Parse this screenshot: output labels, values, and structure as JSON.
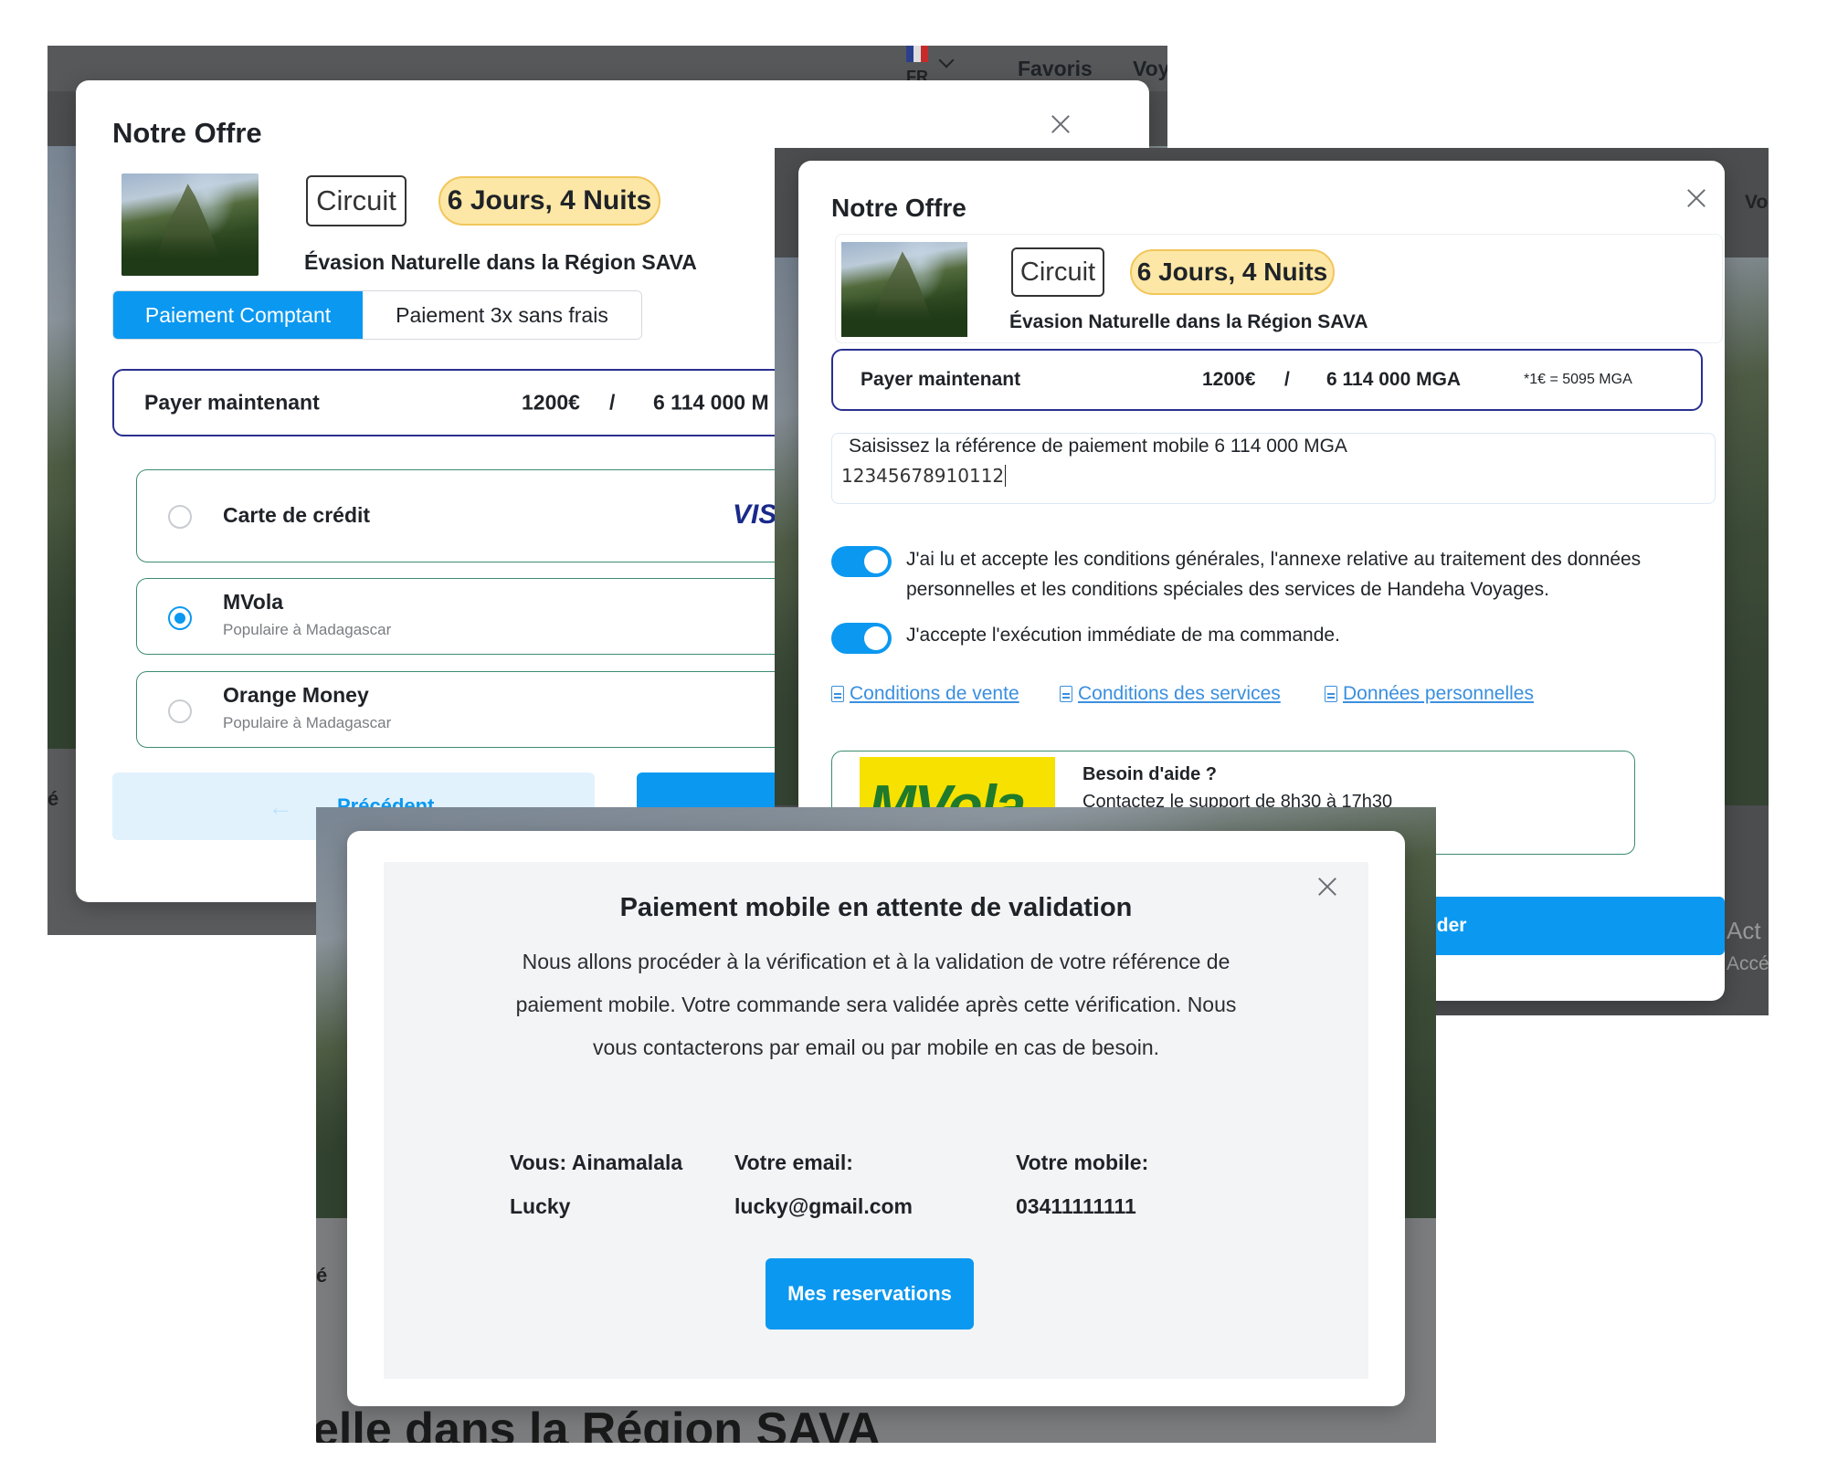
{
  "screenshot1": {
    "nav": {
      "lang": "FR",
      "favorites": "Favoris",
      "voyages_fragment": "Voy"
    },
    "modal": {
      "title": "Notre Offre",
      "badge_type": "Circuit",
      "badge_duration": "6 Jours, 4 Nuits",
      "offer_name": "Évasion Naturelle dans la Région SAVA",
      "tabs": [
        "Paiement Comptant",
        "Paiement 3x sans frais"
      ],
      "pay_label": "Payer maintenant",
      "price_eur": "1200€",
      "separator": "/",
      "price_mga_partial": "6 114 000 M",
      "methods": [
        {
          "title": "Carte de crédit",
          "subtitle": "",
          "selected": false,
          "logo": "VIS"
        },
        {
          "title": "MVola",
          "subtitle": "Populaire à Madagascar",
          "selected": true
        },
        {
          "title": "Orange Money",
          "subtitle": "Populaire à Madagascar",
          "selected": false
        }
      ],
      "prev_button": "Précédent"
    },
    "bg_fragment": "é"
  },
  "screenshot2": {
    "modal": {
      "title": "Notre Offre",
      "badge_type": "Circuit",
      "badge_duration": "6 Jours, 4 Nuits",
      "offer_name": "Évasion Naturelle dans la Région SAVA",
      "pay_label": "Payer maintenant",
      "price_eur": "1200€",
      "separator": "/",
      "price_mga": "6 114 000 MGA",
      "rate": "*1€ = 5095 MGA",
      "ref_label": "Saisissez la référence de paiement mobile 6 114 000 MGA",
      "ref_value": "12345678910112",
      "checkbox1": "J'ai lu et accepte les conditions générales, l'annexe relative au traitement des données personnelles et les conditions spéciales des services de Handeha Voyages.",
      "checkbox2": "J'accepte l'exécution immédiate de ma commande.",
      "links": [
        "Conditions de vente",
        "Conditions des services",
        "Données personnelles"
      ],
      "help_title": "Besoin d'aide ?",
      "help_text": "Contactez le support de 8h30 à 17h30",
      "mvola_logo": "MVola",
      "validate_button": "Valider"
    },
    "side_fragments": [
      "Vo",
      "Act",
      "Accé"
    ]
  },
  "screenshot3": {
    "modal": {
      "title": "Paiement mobile en attente de validation",
      "message": "Nous allons procéder à la vérification et à la validation de votre référence de paiement mobile. Votre commande sera validée après cette vérification. Nous vous contacterons par email ou par mobile en cas de besoin.",
      "you_label": "Vous: Ainamalala",
      "you_value": "Lucky",
      "email_label": "Votre email:",
      "email_value": "lucky@gmail.com",
      "mobile_label": "Votre mobile:",
      "mobile_value": "03411111111",
      "reservations_button": "Mes reservations"
    },
    "bg_title_fragment": "elle dans la Région SAVA",
    "bg_fragment": "é"
  },
  "colors": {
    "primary": "#0b98f0",
    "outline_blue": "#2a2f8f",
    "method_border": "#3b8c6e",
    "duration_badge": "#fde7a6",
    "link": "#3a8fde",
    "mvola_yellow": "#f7e100"
  }
}
